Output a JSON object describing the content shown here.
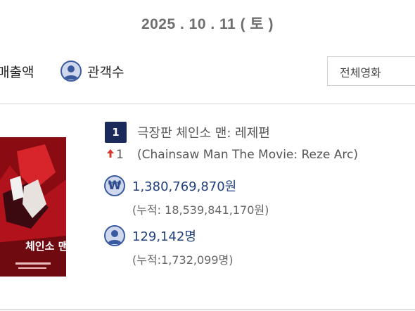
{
  "date": "2025 . 10 . 11 ( 토 )",
  "tabs": {
    "sales": "매출액",
    "audience": "관객수"
  },
  "filter": {
    "selected": "전체영화"
  },
  "movie": {
    "rank": "1",
    "rank_change": "1",
    "title_kr": "극장판 체인소 맨: 레제편",
    "title_en": "(Chainsaw Man The Movie: Reze Arc)",
    "poster_text": "체인소 맨",
    "sales": "1,380,769,870원",
    "sales_cumulative": "(누적: 18,539,841,170원)",
    "audience": "129,142명",
    "audience_cumulative": "(누적:1,732,099명)"
  },
  "icons": {
    "won": "₩",
    "user": "user-icon",
    "up": "up-arrow-icon"
  },
  "colors": {
    "accent": "#1f3f7f",
    "badge": "#1a2a5a",
    "up": "#d9382f"
  }
}
